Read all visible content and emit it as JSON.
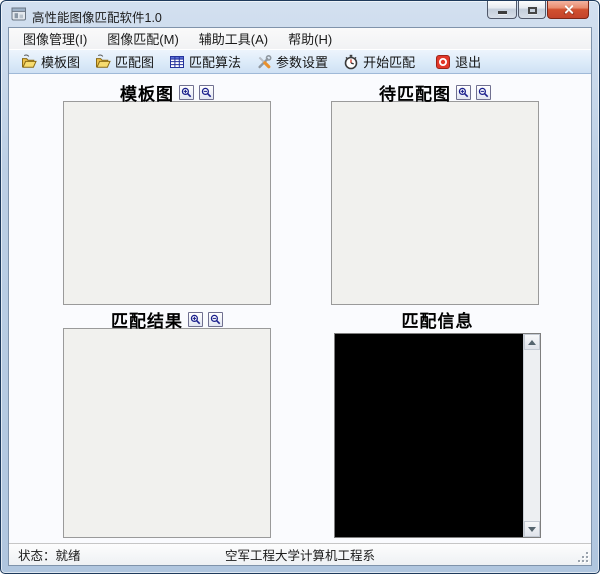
{
  "window": {
    "title": "高性能图像匹配软件1.0",
    "controls": [
      {
        "name": "minimize-button"
      },
      {
        "name": "maximize-button"
      },
      {
        "name": "close-button"
      }
    ],
    "app_icon": "application-window-icon"
  },
  "menu": {
    "items": [
      {
        "label": "图像管理(I)"
      },
      {
        "label": "图像匹配(M)"
      },
      {
        "label": "辅助工具(A)"
      },
      {
        "label": "帮助(H)"
      }
    ]
  },
  "toolbar": {
    "buttons": [
      {
        "label": "模板图",
        "icon": "open-folder-icon"
      },
      {
        "label": "匹配图",
        "icon": "open-folder-icon"
      },
      {
        "label": "匹配算法",
        "icon": "table-grid-icon"
      },
      {
        "label": "参数设置",
        "icon": "tools-icon"
      },
      {
        "label": "开始匹配",
        "icon": "stopwatch-icon"
      },
      {
        "label": "退出",
        "icon": "exit-icon"
      }
    ]
  },
  "panels": [
    {
      "title": "模板图",
      "zoom_icons": [
        "zoom-in-icon",
        "zoom-out-icon"
      ],
      "content": "empty-image-box"
    },
    {
      "title": "待匹配图",
      "zoom_icons": [
        "zoom-in-icon",
        "zoom-out-icon"
      ],
      "content": "empty-image-box"
    },
    {
      "title": "匹配结果",
      "zoom_icons": [
        "zoom-in-icon",
        "zoom-out-icon"
      ],
      "content": "empty-image-box"
    },
    {
      "title": "匹配信息",
      "zoom_icons": [],
      "content": "black-log-box-with-scrollbar"
    }
  ],
  "statusbar": {
    "status": "状态：就绪",
    "affiliation": "空军工程大学计算机工程系"
  },
  "colors": {
    "frame_blue": "#b9cde3",
    "toolbar_blue_top": "#edf4fc",
    "toolbar_blue_bottom": "#cfe1f4",
    "close_button_red": "#c4432b",
    "exit_icon_red": "#e2382a",
    "folder_yellow": "#f0c437",
    "panel_box_bg": "#f1f1ee",
    "log_box_bg": "#000000"
  }
}
